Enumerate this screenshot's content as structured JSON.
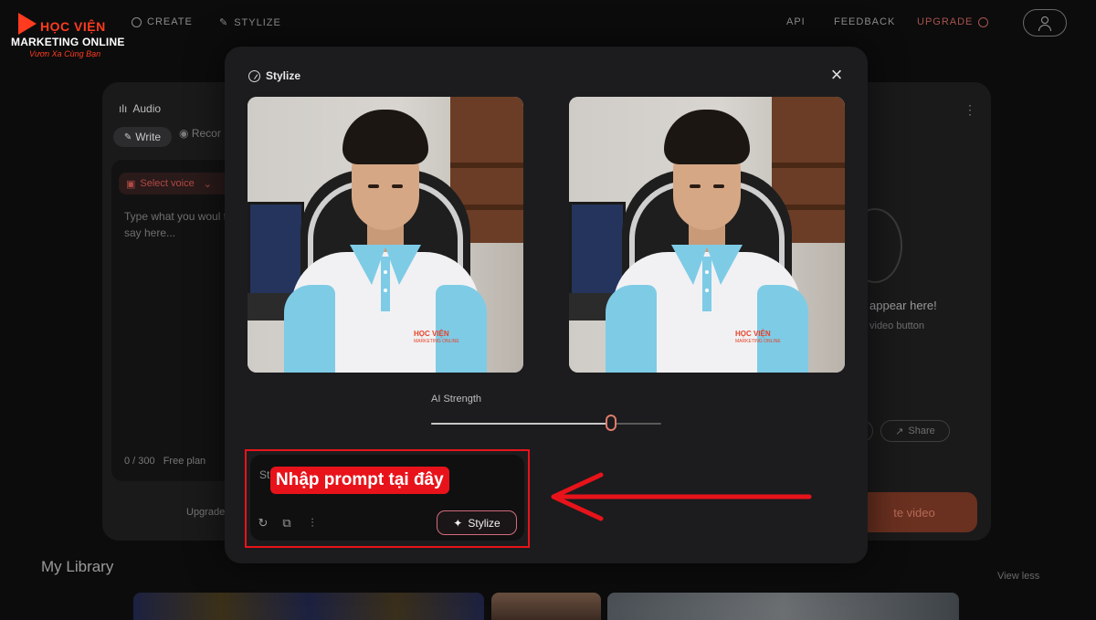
{
  "logo": {
    "line1": "HỌC VIỆN",
    "line2": "MARKETING ONLINE",
    "line3": "Vươn Xa Cùng Bạn"
  },
  "nav": {
    "create": "CREATE",
    "stylize": "STYLIZE",
    "api": "API",
    "feedback": "FEEDBACK",
    "upgrade": "UPGRADE"
  },
  "left_panel": {
    "title": "Audio",
    "tab_write": "Write",
    "tab_record": "Recor",
    "select_voice": "Select voice",
    "placeholder": "Type what you woul to say here...",
    "counter": "0 / 300",
    "plan": "Free plan",
    "upgrade": "Upgrade"
  },
  "right_panel": {
    "appear_text": "appear here!",
    "video_button_text": "video button",
    "share": "Share",
    "create_video": "te video"
  },
  "library": {
    "title": "My Library",
    "view_less": "View less"
  },
  "modal": {
    "title": "Stylize",
    "ai_strength_label": "AI Strength",
    "ai_strength_value": 0.78,
    "prompt_visible_text": "St                                          st pa",
    "stylize_button": "Stylize"
  },
  "annotation": {
    "label": "Nhập prompt tại đây",
    "color": "#e8131a"
  },
  "colors": {
    "accent": "#d46b7a",
    "upgrade": "#a8544c",
    "background": "#0c0c0d",
    "modal": "#1c1c1e"
  }
}
